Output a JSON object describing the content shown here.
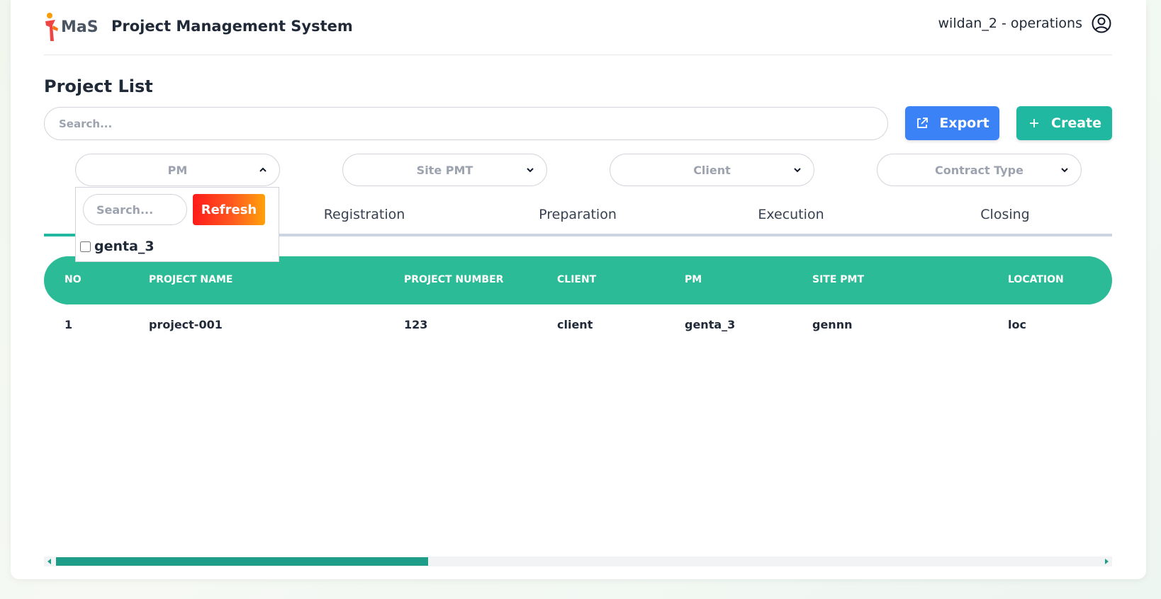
{
  "header": {
    "logo_text": "MaS",
    "app_title": "Project Management System",
    "user": "wildan_2 - operations"
  },
  "page": {
    "title": "Project List",
    "search_placeholder": "Search..."
  },
  "actions": {
    "export_label": "Export",
    "create_label": "Create"
  },
  "filters": {
    "pm": "PM",
    "site_pmt": "Site PMT",
    "client": "Client",
    "contract_type": "Contract Type"
  },
  "pm_dropdown": {
    "search_placeholder": "Search...",
    "refresh_label": "Refresh",
    "options": [
      {
        "label": "genta_3",
        "checked": false
      }
    ]
  },
  "tabs": [
    {
      "label": "Registration"
    },
    {
      "label": "Preparation"
    },
    {
      "label": "Execution"
    },
    {
      "label": "Closing"
    }
  ],
  "table": {
    "headers": [
      "NO",
      "PROJECT NAME",
      "PROJECT NUMBER",
      "CLIENT",
      "PM",
      "SITE PMT",
      "LOCATION"
    ],
    "rows": [
      [
        "1",
        "project-001",
        "123",
        "client",
        "genta_3",
        "gennn",
        "loc"
      ]
    ]
  },
  "colors": {
    "accent": "#20b8a0",
    "table_header": "#2bbb96",
    "export": "#3b82f6"
  }
}
